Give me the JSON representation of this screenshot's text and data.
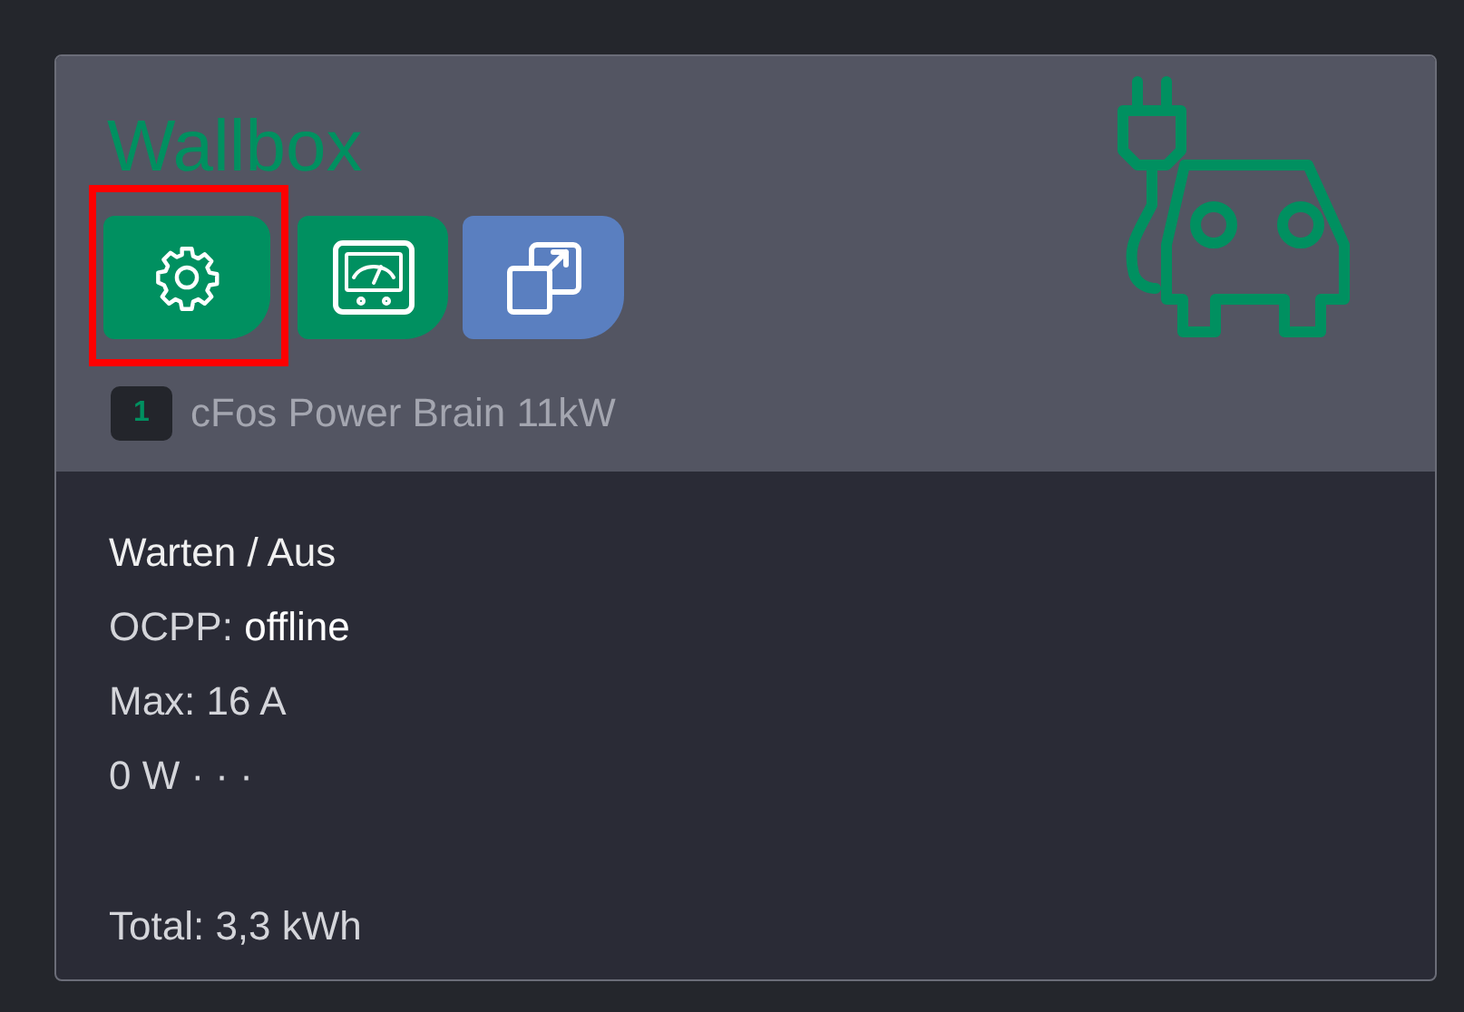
{
  "card": {
    "title": "Wallbox",
    "buttons": [
      {
        "kind": "settings",
        "highlighted": true
      },
      {
        "kind": "meter",
        "highlighted": false
      },
      {
        "kind": "popout",
        "highlighted": false
      }
    ],
    "device": {
      "badge": "1",
      "name": "cFos Power Brain 11kW"
    },
    "lines": [
      {
        "label": "Warten / Aus"
      },
      {
        "label": "OCPP: ",
        "value": "offline"
      },
      {
        "label": "Max: 16 A"
      },
      {
        "label": "0 W · · ·"
      }
    ],
    "total": "Total: 3,3 kWh"
  }
}
